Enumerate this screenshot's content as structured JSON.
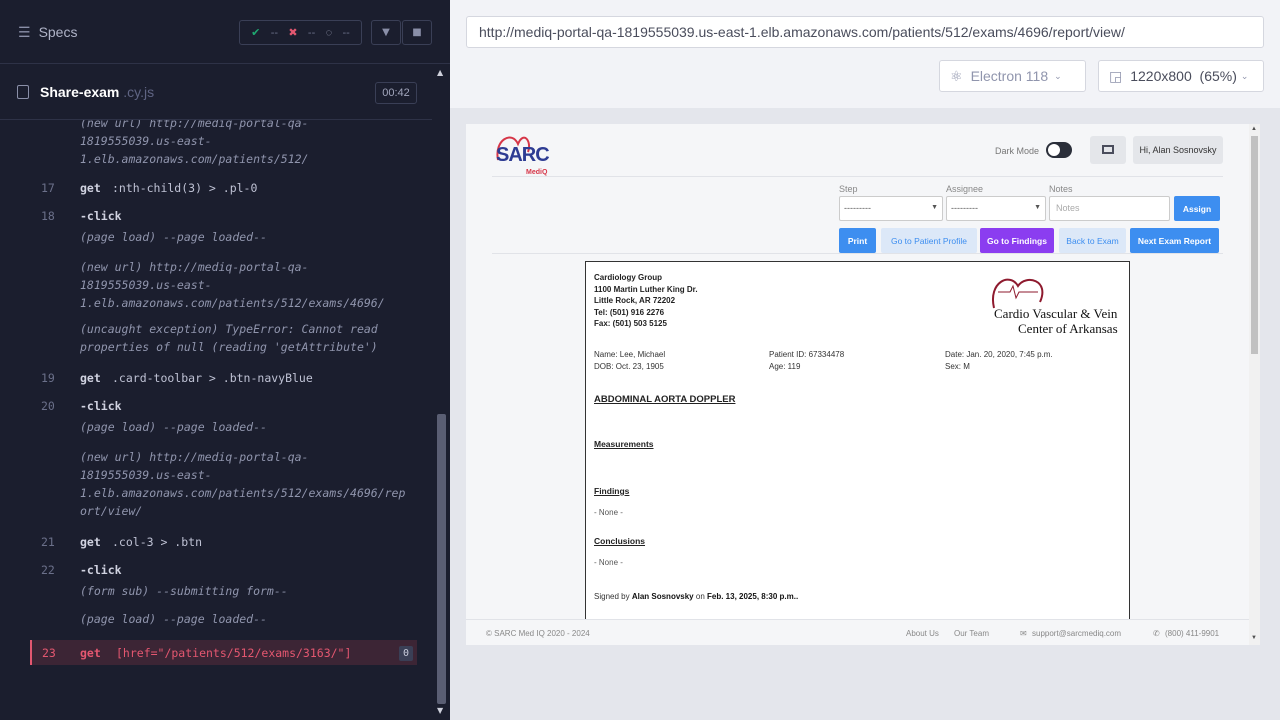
{
  "runner": {
    "specs_label": "Specs",
    "stats": {
      "passed": "--",
      "failed": "--",
      "pending": "--"
    },
    "spec_file": {
      "name": "Share-exam",
      "ext": ".cy.js",
      "duration": "00:42"
    }
  },
  "commands": [
    {
      "kind": "event",
      "lines": [
        "(new url)  http://mediq-portal-qa-",
        "1819555039.us-east-",
        "1.elb.amazonaws.com/patients/512/"
      ]
    },
    {
      "kind": "cmd",
      "num": "17",
      "name": "get",
      "msg": ":nth-child(3) > .pl-0"
    },
    {
      "kind": "cmd",
      "num": "18",
      "name": "-click",
      "msg": ""
    },
    {
      "kind": "event",
      "lines": [
        "(page load)  --page loaded--"
      ]
    },
    {
      "kind": "event",
      "lines": [
        "(new url)  http://mediq-portal-qa-",
        "1819555039.us-east-",
        "1.elb.amazonaws.com/patients/512/exams/4696/"
      ]
    },
    {
      "kind": "event",
      "lines": [
        "(uncaught exception)  TypeError: Cannot read",
        "properties of null (reading 'getAttribute')"
      ]
    },
    {
      "kind": "cmd",
      "num": "19",
      "name": "get",
      "msg": ".card-toolbar > .btn-navyBlue"
    },
    {
      "kind": "cmd",
      "num": "20",
      "name": "-click",
      "msg": ""
    },
    {
      "kind": "event",
      "lines": [
        "(page load)  --page loaded--"
      ]
    },
    {
      "kind": "event",
      "lines": [
        "(new url)  http://mediq-portal-qa-",
        "1819555039.us-east-",
        "1.elb.amazonaws.com/patients/512/exams/4696/rep",
        "ort/view/"
      ]
    },
    {
      "kind": "cmd",
      "num": "21",
      "name": "get",
      "msg": ".col-3 > .btn"
    },
    {
      "kind": "cmd",
      "num": "22",
      "name": "-click",
      "msg": ""
    },
    {
      "kind": "event",
      "lines": [
        "(form sub)  --submitting form--"
      ]
    },
    {
      "kind": "event",
      "lines": [
        "(page load)  --page loaded--"
      ]
    }
  ],
  "failing_command": {
    "num": "23",
    "name": "get",
    "msg": "[href=\"/patients/512/exams/3163/\"]",
    "count": "0"
  },
  "browser": {
    "url": "http://mediq-portal-qa-1819555039.us-east-1.elb.amazonaws.com/patients/512/exams/4696/report/view/",
    "engine": "Electron 118",
    "viewport": "1220x800",
    "zoom": "(65%)"
  },
  "app": {
    "logo_text": "SARC",
    "logo_sub": "MediQ",
    "dark_mode_label": "Dark Mode",
    "user_label": "Hi, Alan Sosnovsky",
    "filters": {
      "step_label": "Step",
      "step_value": "---------",
      "assignee_label": "Assignee",
      "assignee_value": "---------",
      "notes_label": "Notes",
      "notes_placeholder": "Notes",
      "assign_label": "Assign"
    },
    "actions": {
      "print": "Print",
      "patient_profile": "Go to Patient Profile",
      "findings": "Go to Findings",
      "back": "Back to Exam",
      "next": "Next Exam Report"
    },
    "report": {
      "group_lines": [
        "Cardiology Group",
        "1100 Martin Luther King Dr.",
        "Little Rock, AR 72202",
        "Tel: (501) 916 2276",
        "Fax: (501) 503 5125"
      ],
      "clinic_line1": "Cardio Vascular & Vein",
      "clinic_line2": "Center of Arkansas",
      "name": "Name: Lee, Michael",
      "dob": "DOB: Oct. 23, 1905",
      "patient_id": "Patient ID: 67334478",
      "age": "Age: 119",
      "date": "Date: Jan. 20, 2020, 7:45 p.m.",
      "sex": "Sex: M",
      "title": "ABDOMINAL AORTA DOPPLER",
      "measurements": "Measurements",
      "findings": "Findings",
      "findings_value": "- None -",
      "conclusions": "Conclusions",
      "conclusions_value": "- None -",
      "signed_prefix": "Signed by",
      "signer": "Alan Sosnovsky",
      "signed_on": "on",
      "signed_date": "Feb. 13, 2025, 8:30 p.m.."
    },
    "footer": {
      "copyright": "© SARC Med IQ 2020 - 2024",
      "about": "About Us",
      "team": "Our Team",
      "email": "support@sarcmediq.com",
      "phone": "(800) 411-9901"
    }
  }
}
